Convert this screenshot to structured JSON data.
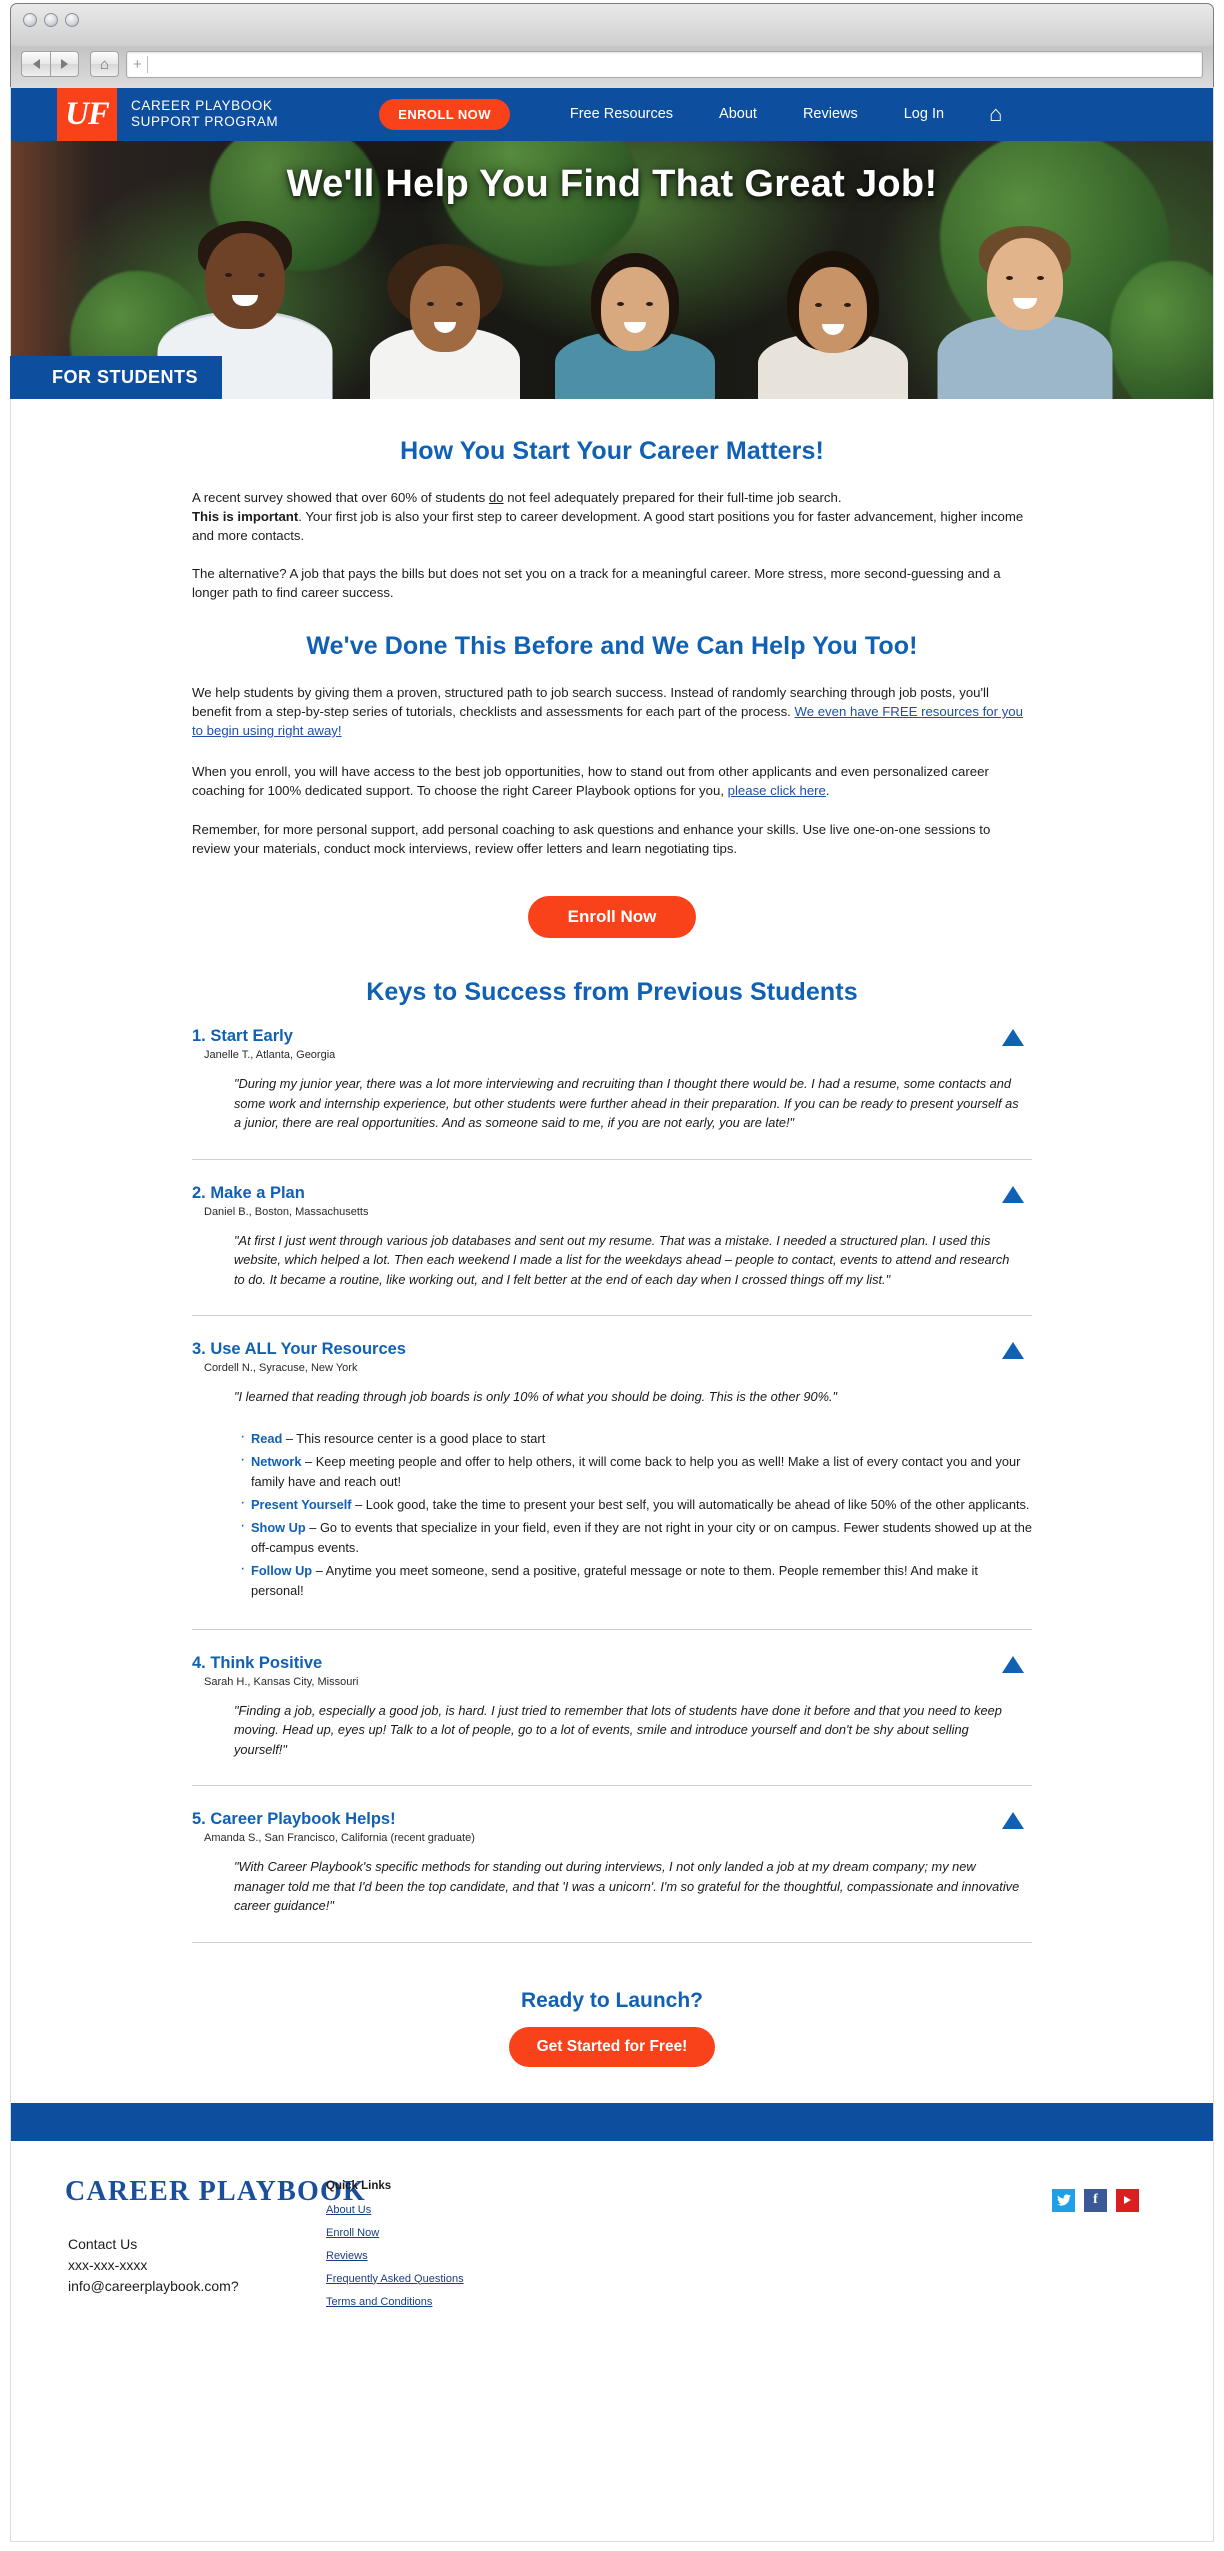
{
  "browser": {
    "url_value": "",
    "url_placeholder": "",
    "back_icon": "back-arrow-icon",
    "forward_icon": "forward-arrow-icon",
    "home_icon": "home-icon",
    "new_tab_glyph": "+"
  },
  "header": {
    "logo_text": "UF",
    "brand_line1": "CAREER PLAYBOOK",
    "brand_line2": "SUPPORT PROGRAM",
    "enroll_label": "ENROLL NOW",
    "nav": [
      {
        "label": "Free Resources"
      },
      {
        "label": "About"
      },
      {
        "label": "Reviews"
      },
      {
        "label": "Log In"
      }
    ],
    "home_icon": "home-icon",
    "brand_color": "#0d4f9e",
    "accent_color": "#f9421a"
  },
  "hero": {
    "title": "We'll Help You Find That Great Job!",
    "badge": "FOR STUDENTS"
  },
  "section1": {
    "heading": "How You Start Your Career Matters!",
    "p1_a": "A recent survey showed that over 60% of students ",
    "p1_do": "do",
    "p1_b": " not feel adequately prepared for their full-time job search.",
    "p1_bold": "This is important",
    "p1_c": ". Your first job is also your first step to career development. A good start positions you for faster advancement, higher income and more contacts.",
    "p2": "The alternative? A job that pays the bills but does not set you on a track for a meaningful career. More stress, more second-guessing and a longer path to find career success."
  },
  "section2": {
    "heading": "We've Done This Before and We Can Help You Too!",
    "p1_a": "We help students by giving them a proven, structured path to job search success. Instead of randomly searching through job posts, you'll benefit from a step-by-step series of tutorials, checklists and assessments for each part of the process. ",
    "p1_link": "We even have FREE resources for you to begin using right away!",
    "p2_a": "When you enroll, you will have access to the best job opportunities, how to stand out from other applicants and even personalized career coaching for 100% dedicated support. To choose the right Career Playbook options for you, ",
    "p2_link": "please click here",
    "p2_b": ".",
    "p3": "Remember, for more personal support, add personal coaching to ask questions and enhance your skills. Use live one-on-one sessions to review your materials, conduct mock interviews, review offer letters and learn negotiating tips.",
    "cta_label": "Enroll Now"
  },
  "keys": {
    "heading": "Keys to Success from Previous Students",
    "items": [
      {
        "title": "1. Start Early",
        "author": "Janelle T., Atlanta, Georgia",
        "quote": "\"During my junior year, there was a lot more interviewing and recruiting than I thought there would be. I had a resume, some contacts and some work and internship experience, but other students were further ahead in their preparation. If you can be ready to present yourself as a junior, there are real opportunities. And as someone said to me, if you are not early, you are late!\"",
        "arrow": "triangle-up-icon"
      },
      {
        "title": "2. Make a Plan",
        "author": "Daniel B., Boston, Massachusetts",
        "quote": "\"At first I just went through various job databases and sent out my resume. That was a mistake. I needed a structured plan. I used this website, which helped a lot. Then each weekend I made a list for the weekdays ahead – people to contact, events to attend and research to do. It became a routine, like working out, and I felt better at the end of each day when I crossed things off my list.\"",
        "arrow": "triangle-up-icon"
      },
      {
        "title": "3. Use ALL Your Resources",
        "author": "Cordell N., Syracuse, New York",
        "quote": "\"I learned that reading through job boards is only 10% of what you should be doing. This is the other 90%.\"",
        "arrow": "triangle-up-icon",
        "bullets": [
          {
            "lead": "Read",
            "text": " – This resource center is a good place to start"
          },
          {
            "lead": "Network",
            "text": " – Keep meeting people and offer to help others, it will come back to help you as well! Make a list of every contact you and your family have and reach out!"
          },
          {
            "lead": "Present Yourself",
            "text": " – Look good, take the time to present your best self, you will automatically be ahead of like 50% of the other applicants."
          },
          {
            "lead": "Show Up",
            "text": " – Go to events that specialize in your field, even if they are not right in your city or on campus. Fewer students showed up at the off-campus events."
          },
          {
            "lead": "Follow Up",
            "text": " – Anytime you meet someone, send a positive, grateful message or note to them. People remember this! And make it personal!"
          }
        ]
      },
      {
        "title": "4. Think Positive",
        "author": "Sarah H., Kansas City, Missouri",
        "quote": "\"Finding a job, especially a good job, is hard. I just tried to remember that lots of students have done it before and that you need to keep moving. Head up, eyes up! Talk to a lot of people, go to a lot of events, smile and introduce yourself and don't be shy about selling yourself!\"",
        "arrow": "triangle-up-icon"
      },
      {
        "title": "5. Career Playbook Helps!",
        "author": "Amanda S., San Francisco, California (recent graduate)",
        "quote": "\"With Career Playbook's specific methods for standing out during interviews, I not only landed a job at my dream company; my new manager told me that I'd been the top candidate, and that 'I was a unicorn'. I'm so grateful for the thoughtful, compassionate and innovative career guidance!\"",
        "arrow": "triangle-up-icon"
      }
    ]
  },
  "launch": {
    "heading": "Ready to Launch?",
    "cta_label": "Get Started for Free!"
  },
  "footer": {
    "logo": "CAREER PLAYBOOK",
    "contact_title": "Contact Us",
    "phone": "xxx-xxx-xxxx",
    "email": "info@careerplaybook.com?",
    "quick_links_title": "Quick Links",
    "links": [
      {
        "label": "About Us"
      },
      {
        "label": "Enroll Now"
      },
      {
        "label": "Reviews"
      },
      {
        "label": "Frequently Asked Questions"
      },
      {
        "label": "Terms and Conditions"
      }
    ],
    "social": [
      {
        "name": "twitter-icon",
        "glyph": "🐦"
      },
      {
        "name": "facebook-icon",
        "glyph": "f"
      },
      {
        "name": "youtube-icon",
        "glyph": "▶"
      }
    ]
  }
}
